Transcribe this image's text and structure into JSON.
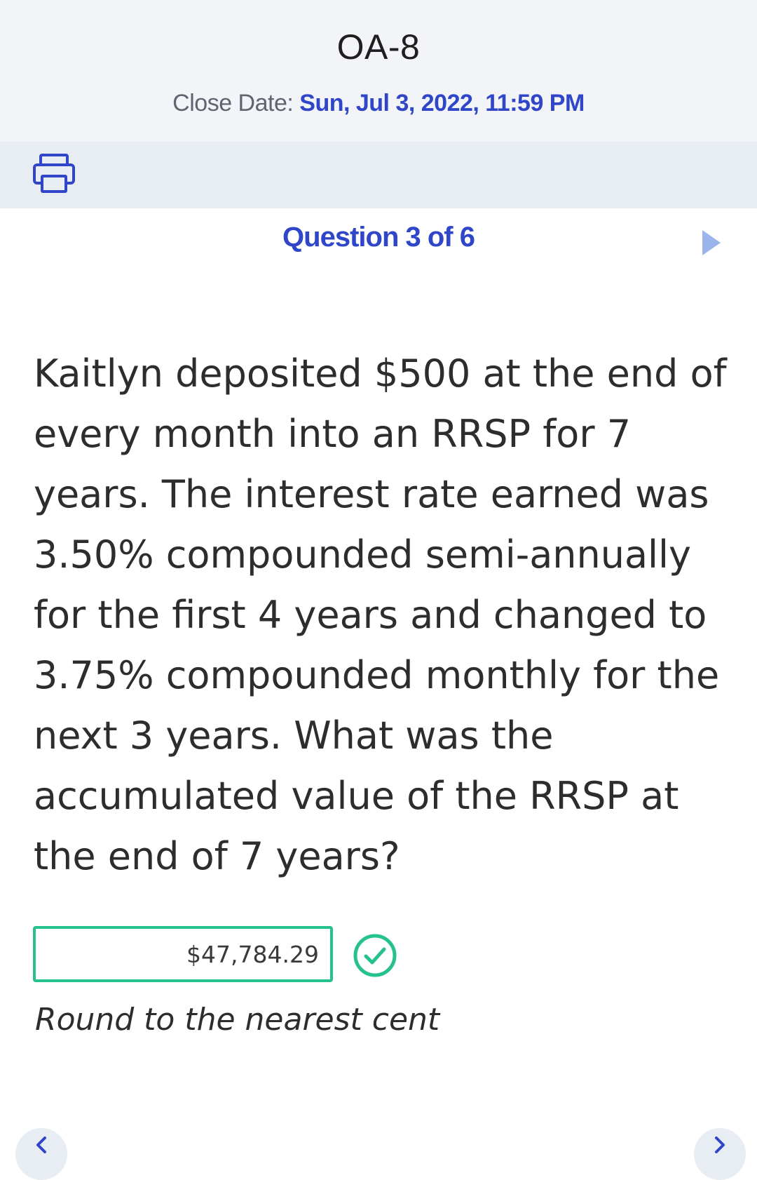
{
  "header": {
    "title": "OA-8",
    "close_date_label": "Close Date: ",
    "close_date_value": "Sun, Jul 3, 2022, 11:59 PM"
  },
  "toolbar": {
    "print_icon": "printer-icon"
  },
  "navigation": {
    "question_label": "Question 3 of 6",
    "next_icon": "play-triangle-icon",
    "bottom_prev_icon": "chevron-left-icon",
    "bottom_next_icon": "chevron-right-icon"
  },
  "question": {
    "text": "Kaitlyn deposited $500 at the end of every month into an RRSP for 7 years. The interest rate earned was 3.50% compounded semi-annually for the first 4 years and changed to 3.75% compounded monthly for the next 3 years. What was the accumulated value of the RRSP at the end of 7 years?"
  },
  "answer": {
    "value": "$47,784.29",
    "status_icon": "check-circle-icon",
    "hint": "Round to the nearest cent"
  },
  "colors": {
    "accent_blue": "#2f46c9",
    "correct_green": "#25c18e",
    "header_bg": "#f3f4f7",
    "toolbar_bg": "#e8ecf3"
  }
}
